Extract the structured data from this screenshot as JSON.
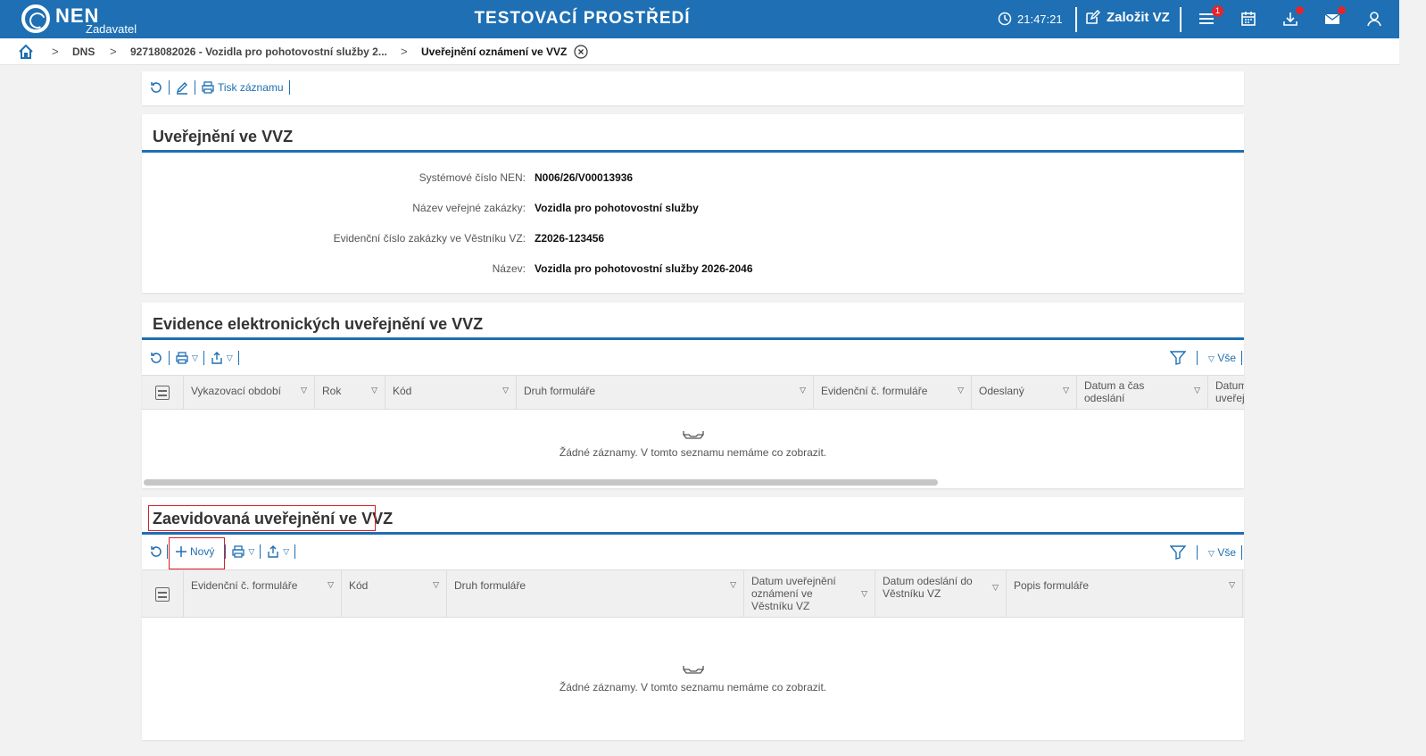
{
  "header": {
    "logo": "NEN",
    "logo_sub": "Zadavatel",
    "environment": "TESTOVACÍ PROSTŘEDÍ",
    "time": "21:47:21",
    "create_label": "Založit VZ",
    "menu_badge": "1"
  },
  "breadcrumb": {
    "items": [
      "DNS",
      "92718082026 - Vozidla pro pohotovostní služby 2...",
      "Uveřejnění oznámení ve VVZ"
    ]
  },
  "top_toolbar": {
    "print_label": "Tisk záznamu"
  },
  "detail": {
    "title": "Uveřejnění ve VVZ",
    "fields": [
      {
        "label": "Systémové číslo NEN:",
        "value": "N006/26/V00013936"
      },
      {
        "label": "Název veřejné zakázky:",
        "value": "Vozidla pro pohotovostní služby"
      },
      {
        "label": "Evidenční číslo zakázky ve Věstníku VZ:",
        "value": "Z2026-123456"
      },
      {
        "label": "Název:",
        "value": "Vozidla pro pohotovostní služby 2026-2046"
      }
    ]
  },
  "evidence": {
    "title": "Evidence elektronických uveřejnění ve VVZ",
    "filter_all": "Vše",
    "columns": [
      "Vykazovací období",
      "Rok",
      "Kód",
      "Druh formuláře",
      "Evidenční č. formuláře",
      "Odeslaný",
      "Datum a čas odeslání",
      "Datum uveřej"
    ],
    "empty_text": "Žádné záznamy. V tomto seznamu nemáme co zobrazit."
  },
  "registered": {
    "title": "Zaevidovaná uveřejnění ve VVZ",
    "new_label": "Nový",
    "filter_all": "Vše",
    "columns": [
      "Evidenční č. formuláře",
      "Kód",
      "Druh formuláře",
      "Datum uveřejnění oznámení ve Věstníku VZ",
      "Datum odeslání do Věstníku VZ",
      "Popis formuláře"
    ],
    "empty_text": "Žádné záznamy. V tomto seznamu nemáme co zobrazit."
  },
  "colors": {
    "brand": "#1e6fb3",
    "highlight": "#d62028",
    "badge": "#e2262b"
  }
}
